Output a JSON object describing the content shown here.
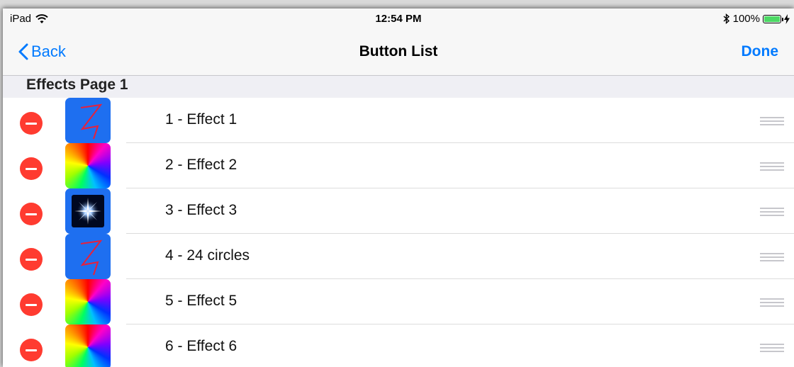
{
  "status": {
    "device": "iPad",
    "time": "12:54 PM",
    "battery_text": "100%",
    "battery_level": 1.0,
    "battery_color": "#4cd964"
  },
  "nav": {
    "back_label": "Back",
    "title": "Button List",
    "done_label": "Done",
    "tint_color": "#007aff"
  },
  "section": {
    "title": "Effects Page 1"
  },
  "rows": [
    {
      "label": "1 - Effect 1",
      "thumb": "lightning-icon"
    },
    {
      "label": "2 - Effect 2",
      "thumb": "color-wheel-icon"
    },
    {
      "label": "3 - Effect 3",
      "thumb": "star-burst-icon"
    },
    {
      "label": "4 - 24 circles",
      "thumb": "lightning-icon"
    },
    {
      "label": "5 - Effect 5",
      "thumb": "color-wheel-icon"
    },
    {
      "label": "6 - Effect 6",
      "thumb": "color-wheel-icon"
    }
  ],
  "delete_color": "#ff3b30"
}
